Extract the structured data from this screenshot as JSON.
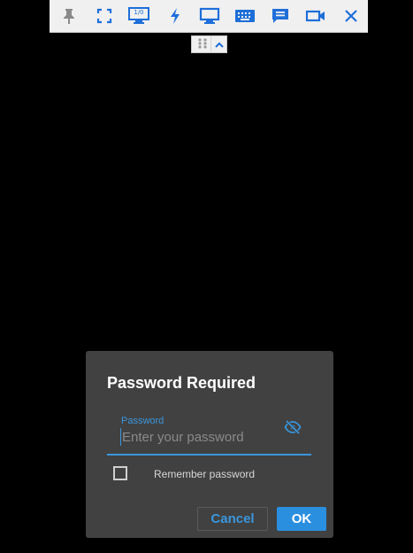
{
  "toolbar": {
    "items": [
      {
        "icon": "pin-icon",
        "color": "#8a8a8a"
      },
      {
        "icon": "fullscreen-icon",
        "color": "#1e6fd9"
      },
      {
        "icon": "monitor-select-icon",
        "badge": "1/0",
        "color": "#1e6fd9"
      },
      {
        "icon": "lightning-icon",
        "color": "#1e6fd9"
      },
      {
        "icon": "display-icon",
        "color": "#1e6fd9"
      },
      {
        "icon": "keyboard-icon",
        "color": "#1e6fd9"
      },
      {
        "icon": "chat-icon",
        "color": "#1e6fd9"
      },
      {
        "icon": "video-icon",
        "color": "#1e6fd9"
      },
      {
        "icon": "close-icon",
        "color": "#1e6fd9"
      }
    ]
  },
  "handle": {
    "grip_icon": "drag-grip-icon",
    "collapse_icon": "chevron-up-icon"
  },
  "dialog": {
    "title": "Password Required",
    "password": {
      "label": "Password",
      "placeholder": "Enter your password",
      "value": "",
      "toggle_icon": "eye-off-icon"
    },
    "remember": {
      "label": "Remember password",
      "checked": false
    },
    "cancel_label": "Cancel",
    "ok_label": "OK"
  },
  "colors": {
    "accent": "#3a96dd",
    "toolbar_icon": "#1e6fd9",
    "dialog_bg": "#414141",
    "page_bg": "#000000"
  }
}
